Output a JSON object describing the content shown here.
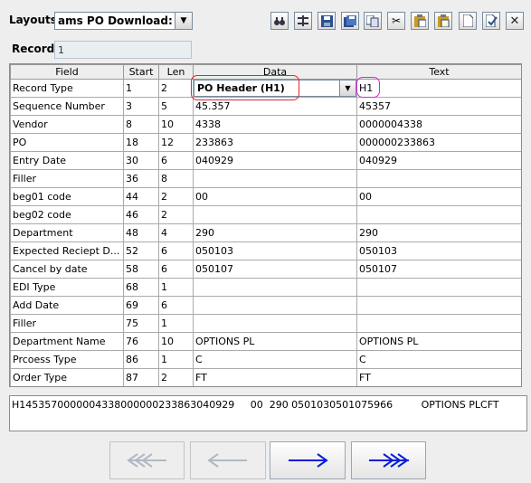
{
  "layouts": {
    "label": "Layouts",
    "selected": "ams PO Download: H..."
  },
  "toolbar": {
    "icons": [
      "binoculars-icon",
      "columns-icon",
      "save-icon",
      "save-as-icon",
      "copy-icon",
      "cut-icon",
      "paste-icon",
      "paste-prior-icon",
      "new-icon",
      "edit-icon",
      "close-icon"
    ]
  },
  "record": {
    "label": "Record",
    "value": "1"
  },
  "grid": {
    "columns": [
      "Field",
      "Start",
      "Len",
      "Data",
      "Text"
    ],
    "rows": [
      {
        "field": "Record Type",
        "start": "1",
        "len": "2",
        "data": "PO Header (H1)",
        "text": "H1"
      },
      {
        "field": "Sequence Number",
        "start": "3",
        "len": "5",
        "data": "45.357",
        "text": "45357"
      },
      {
        "field": "Vendor",
        "start": "8",
        "len": "10",
        "data": "4338",
        "text": "0000004338"
      },
      {
        "field": "PO",
        "start": "18",
        "len": "12",
        "data": "233863",
        "text": "000000233863"
      },
      {
        "field": "Entry Date",
        "start": "30",
        "len": "6",
        "data": "040929",
        "text": "040929"
      },
      {
        "field": "Filler",
        "start": "36",
        "len": "8",
        "data": "",
        "text": ""
      },
      {
        "field": "beg01 code",
        "start": "44",
        "len": "2",
        "data": "00",
        "text": "00"
      },
      {
        "field": "beg02 code",
        "start": "46",
        "len": "2",
        "data": "",
        "text": ""
      },
      {
        "field": "Department",
        "start": "48",
        "len": "4",
        "data": "290",
        "text": "290"
      },
      {
        "field": "Expected Reciept D...",
        "start": "52",
        "len": "6",
        "data": "050103",
        "text": "050103"
      },
      {
        "field": "Cancel by date",
        "start": "58",
        "len": "6",
        "data": "050107",
        "text": "050107"
      },
      {
        "field": "EDI Type",
        "start": "68",
        "len": "1",
        "data": "",
        "text": ""
      },
      {
        "field": "Add Date",
        "start": "69",
        "len": "6",
        "data": "",
        "text": ""
      },
      {
        "field": "Filler",
        "start": "75",
        "len": "1",
        "data": "",
        "text": ""
      },
      {
        "field": "Department Name",
        "start": "76",
        "len": "10",
        "data": "OPTIONS PL",
        "text": "OPTIONS PL"
      },
      {
        "field": "Prcoess Type",
        "start": "86",
        "len": "1",
        "data": "C",
        "text": "C"
      },
      {
        "field": "Order Type",
        "start": "87",
        "len": "2",
        "data": "FT",
        "text": "FT"
      }
    ]
  },
  "raw_line": "H1453570000004338000000233863040929     00  290 0501030501075966         OPTIONS PLCFT",
  "nav": {
    "buttons": [
      "first-icon",
      "prev-icon",
      "next-icon",
      "last-icon"
    ]
  }
}
